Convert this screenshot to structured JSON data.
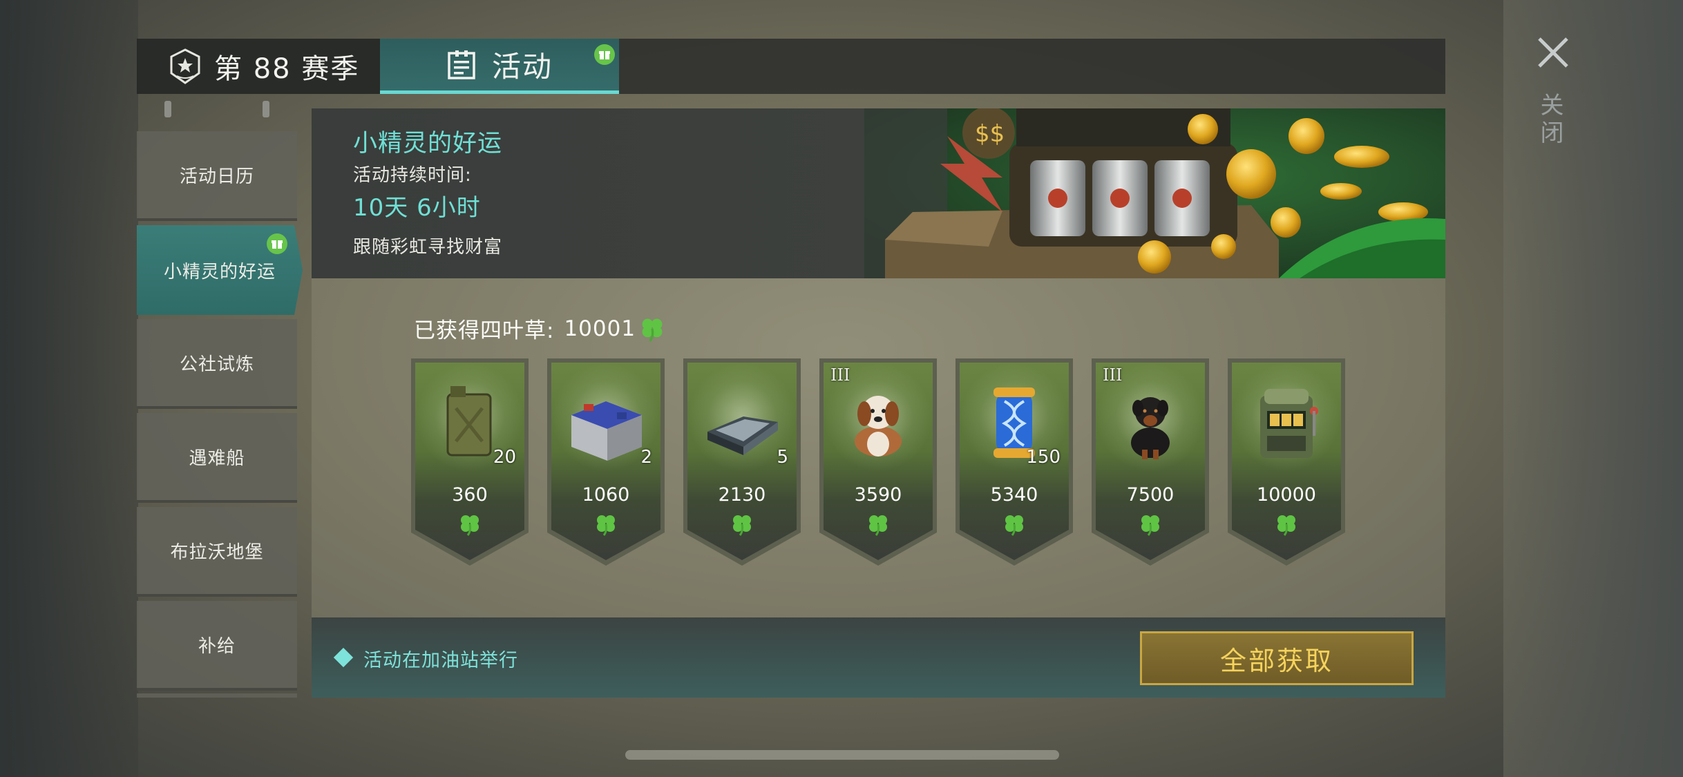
{
  "tabs": {
    "season_label": "第 88 赛季",
    "activity_label": "活动"
  },
  "close": {
    "label": "关闭"
  },
  "sidebar": {
    "items": [
      {
        "label": "活动日历",
        "active": false
      },
      {
        "label": "小精灵的好运",
        "active": true,
        "gift": true
      },
      {
        "label": "公社试炼",
        "active": false
      },
      {
        "label": "遇难船",
        "active": false
      },
      {
        "label": "布拉沃地堡",
        "active": false
      },
      {
        "label": "补给",
        "active": false
      }
    ]
  },
  "banner": {
    "title": "小精灵的好运",
    "duration_label": "活动持续时间:",
    "duration": "10天 6小时",
    "description": "跟随彩虹寻找财富"
  },
  "progress": {
    "label": "已获得四叶草:",
    "value": "10001"
  },
  "rewards": [
    {
      "icon": "fuel-canister-icon",
      "qty": "20",
      "tier": "",
      "cost": "360"
    },
    {
      "icon": "battery-icon",
      "qty": "2",
      "tier": "",
      "cost": "1060"
    },
    {
      "icon": "metal-ingot-icon",
      "qty": "5",
      "tier": "",
      "cost": "2130"
    },
    {
      "icon": "saint-bernard-dog-icon",
      "qty": "",
      "tier": "III",
      "cost": "3590"
    },
    {
      "icon": "dna-capsule-icon",
      "qty": "150",
      "tier": "",
      "cost": "5340"
    },
    {
      "icon": "rottweiler-dog-icon",
      "qty": "",
      "tier": "III",
      "cost": "7500"
    },
    {
      "icon": "slot-machine-icon",
      "qty": "",
      "tier": "",
      "cost": "10000"
    }
  ],
  "footer": {
    "location_text": "活动在加油站举行",
    "claim_all_label": "全部获取"
  },
  "colors": {
    "accent_teal": "#6fe0d6",
    "clover_green": "#67c44a",
    "button_gold": "#f6d35c"
  }
}
